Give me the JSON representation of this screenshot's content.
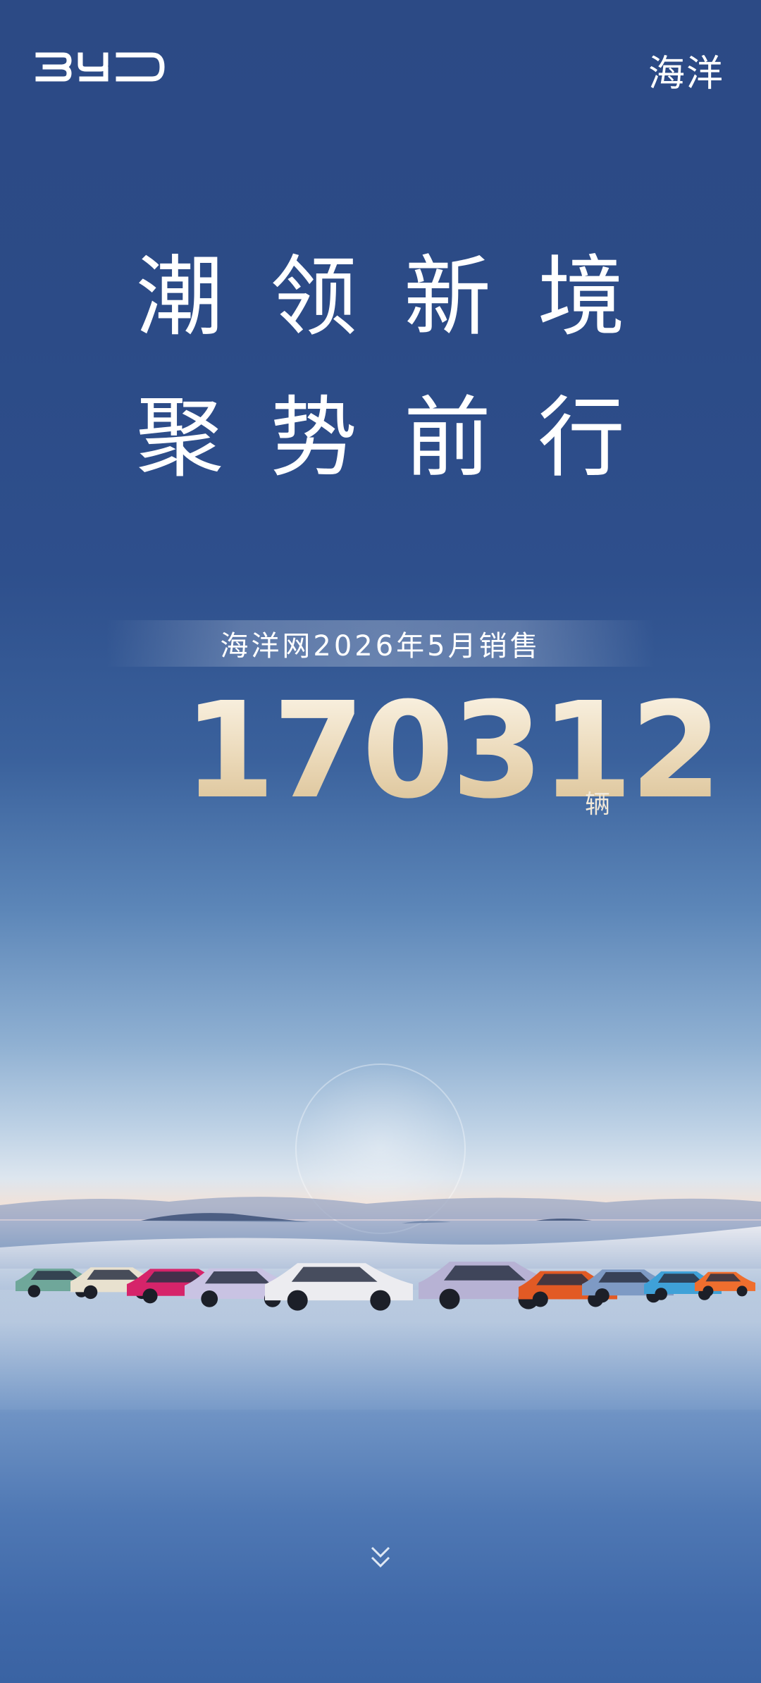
{
  "header": {
    "brand_logo_text": "BYD",
    "sub_brand": "海洋"
  },
  "headline": {
    "line1": "潮领新境",
    "line2": "聚势前行"
  },
  "sales": {
    "banner": "海洋网2026年5月销售",
    "count": "170312",
    "unit": "辆"
  },
  "colors": {
    "background_top": "#2c4a85",
    "number_gold": "#e9d6b4",
    "text": "#ffffff"
  },
  "cars": [
    {
      "color": "#6fa79a"
    },
    {
      "color": "#e8e1cf"
    },
    {
      "color": "#d6246a"
    },
    {
      "color": "#c9c3e3"
    },
    {
      "color": "#ececf0"
    },
    {
      "color": "#b7b2d4"
    },
    {
      "color": "#e25a24"
    },
    {
      "color": "#7e9ac4"
    },
    {
      "color": "#3fa1d8"
    },
    {
      "color": "#ef6e2e"
    }
  ],
  "icons": {
    "scroll_down": "chevron-double-down-icon"
  }
}
